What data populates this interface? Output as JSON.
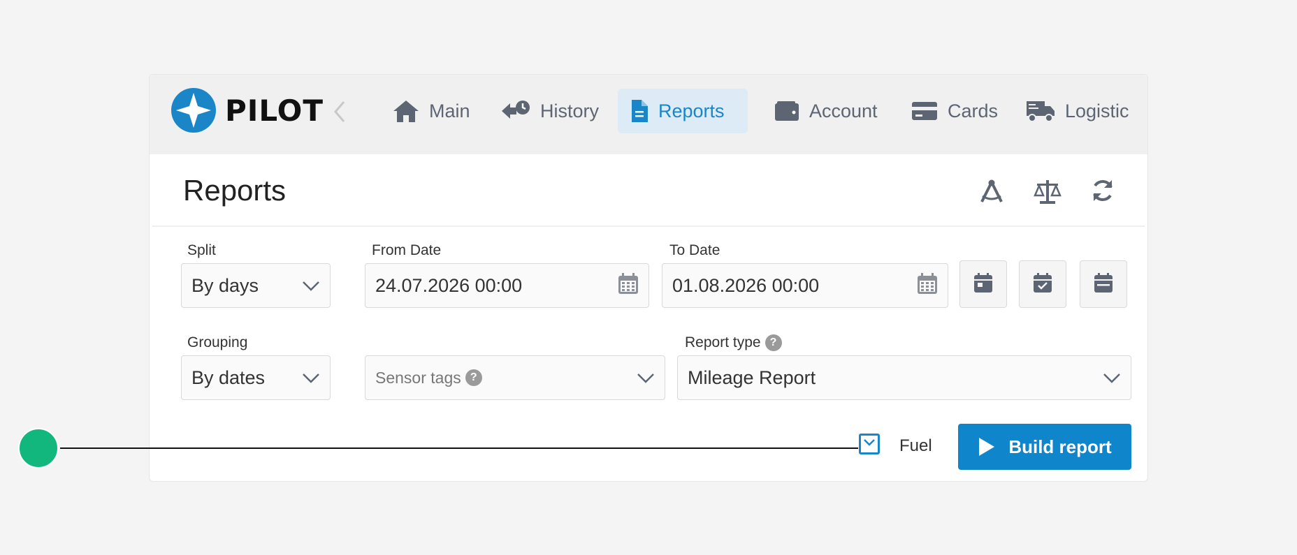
{
  "colors": {
    "accent": "#0f86cc",
    "active_tab_bg": "#dcebf5",
    "marker": "#12b77d"
  },
  "brand": {
    "name": "PILOT"
  },
  "nav": {
    "items": [
      {
        "label": "Main",
        "icon": "home-icon",
        "active": false
      },
      {
        "label": "History",
        "icon": "history-icon",
        "active": false
      },
      {
        "label": "Reports",
        "icon": "document-icon",
        "active": true
      },
      {
        "label": "Account",
        "icon": "wallet-icon",
        "active": false
      },
      {
        "label": "Cards",
        "icon": "credit-card-icon",
        "active": false
      },
      {
        "label": "Logistic",
        "icon": "truck-icon",
        "active": false
      }
    ]
  },
  "page": {
    "title": "Reports"
  },
  "header_icons": [
    "compass-icon",
    "scales-icon",
    "refresh-icon"
  ],
  "form": {
    "split": {
      "label": "Split",
      "value": "By days"
    },
    "from_date": {
      "label": "From Date",
      "value": "24.07.2026 00:00"
    },
    "to_date": {
      "label": "To Date",
      "value": "01.08.2026 00:00"
    },
    "quick_dates": [
      "calendar-day-icon",
      "calendar-check-icon",
      "calendar-range-icon"
    ],
    "grouping": {
      "label": "Grouping",
      "value": "By dates"
    },
    "sensor_tags": {
      "placeholder": "Sensor tags"
    },
    "report_type": {
      "label": "Report type",
      "value": "Mileage Report"
    },
    "fuel": {
      "label": "Fuel",
      "checked": true
    },
    "build_button": {
      "label": "Build report"
    }
  }
}
